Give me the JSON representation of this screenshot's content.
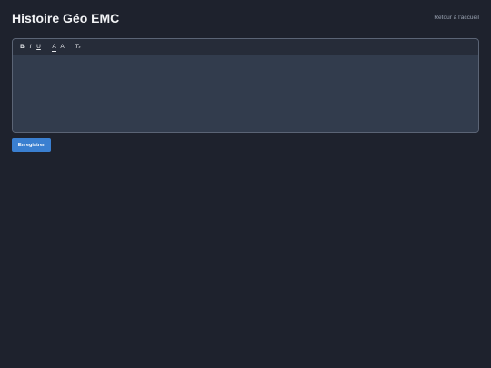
{
  "header": {
    "title": "Histoire Géo EMC",
    "home_link": "Retour à l'accueil"
  },
  "toolbar": {
    "bold": "B",
    "italic": "I",
    "underline": "U",
    "text_color": "A",
    "background_color": "A",
    "clear_format": "T",
    "clear_format_sub": "x"
  },
  "editor": {
    "content": ""
  },
  "actions": {
    "save_label": "Enregistrer"
  },
  "colors": {
    "background": "#1e222d",
    "editor_background": "#323c4d",
    "toolbar_background": "#262c39",
    "primary_button": "#3a7fd0",
    "title_text": "#f2f3f5",
    "link_text": "#9aa3b2"
  }
}
